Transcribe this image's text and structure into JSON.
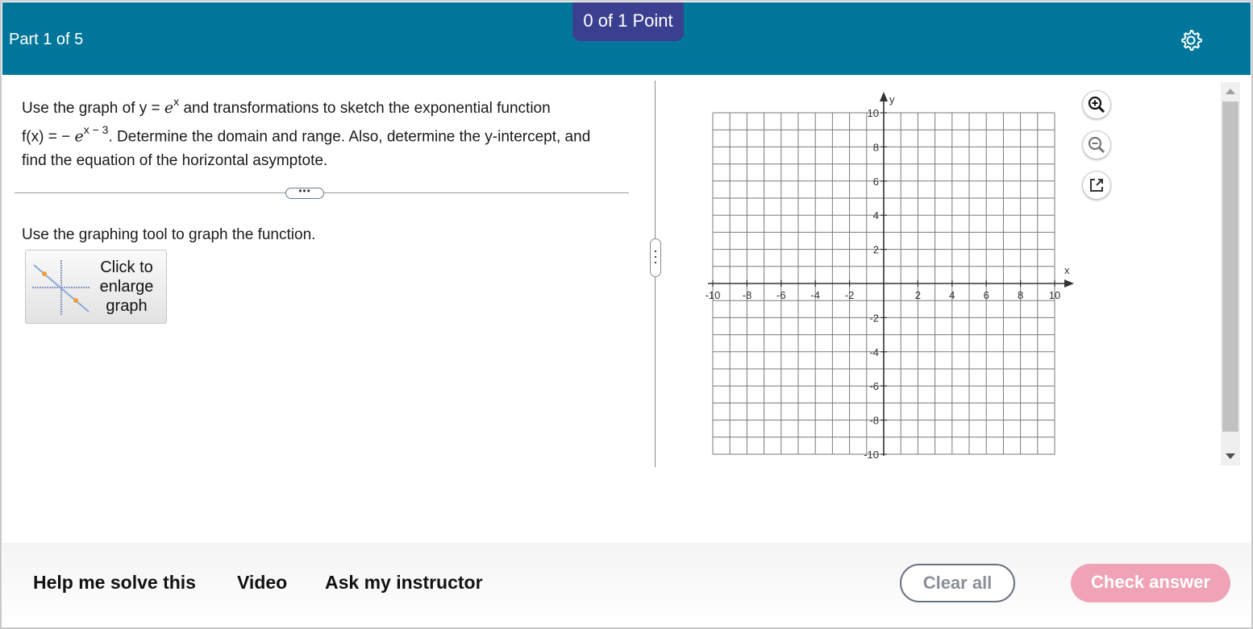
{
  "header": {
    "part_label": "Part 1 of 5",
    "points_badge": "0 of 1 Point",
    "settings_icon": "gear-icon",
    "colors": {
      "header_bg": "#00779a",
      "badge_bg": "#3a3f8f"
    }
  },
  "question": {
    "line1_a": "Use the graph of y = ",
    "line1_e": "e",
    "line1_sup": "x",
    "line1_b": " and transformations to sketch the exponential function",
    "line2_a": "f(x) = − ",
    "line2_e": "e",
    "line2_sup": "x − 3",
    "line2_b": ". Determine the domain and range. Also, determine the y-intercept, and",
    "line3": "find the equation of the horizontal asymptote."
  },
  "more_pill": "•••",
  "instruction": "Use the graphing tool to graph the function.",
  "enlarge_button": {
    "line1": "Click to",
    "line2": "enlarge",
    "line3": "graph"
  },
  "graph": {
    "x_axis_label": "x",
    "y_axis_label": "y",
    "x_ticks": [
      "-10",
      "-8",
      "-6",
      "-4",
      "-2",
      "2",
      "4",
      "6",
      "8",
      "10"
    ],
    "y_ticks": [
      "10",
      "8",
      "6",
      "4",
      "2",
      "-2",
      "-4",
      "-6",
      "-8",
      "-10"
    ],
    "xlim": [
      -10,
      10
    ],
    "ylim": [
      -10,
      10
    ],
    "grid": true
  },
  "tools": {
    "zoom_in_icon": "zoom-in-icon",
    "zoom_out_icon": "zoom-out-icon",
    "popout_icon": "external-link-icon"
  },
  "footer": {
    "help_link": "Help me solve this",
    "video_link": "Video",
    "ask_link": "Ask my instructor",
    "clear_button": "Clear all",
    "check_button": "Check answer",
    "colors": {
      "check_bg": "#f0a3b6"
    }
  }
}
